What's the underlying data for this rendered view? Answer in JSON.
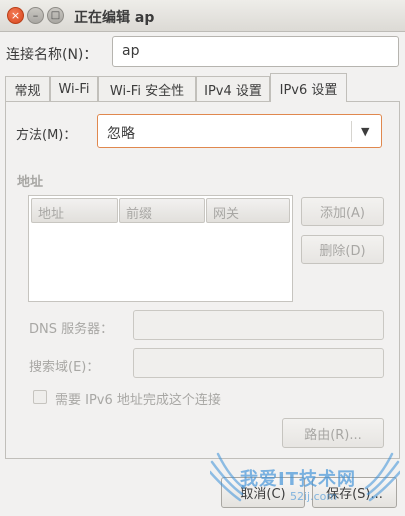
{
  "window": {
    "title": "正在编辑 ap",
    "close_glyph": "×",
    "minimize_glyph": "–",
    "maximize_glyph": "□"
  },
  "connection_name": {
    "label": "连接名称(N)：",
    "value": "ap"
  },
  "tabs": [
    {
      "label": "常规",
      "active": false
    },
    {
      "label": "Wi-Fi",
      "active": false
    },
    {
      "label": "Wi-Fi 安全性",
      "active": false
    },
    {
      "label": "IPv4 设置",
      "active": false
    },
    {
      "label": "IPv6 设置",
      "active": true
    }
  ],
  "ipv6": {
    "method_label": "方法(M)：",
    "method_value": "忽略",
    "address_section": "地址",
    "address_columns": [
      "地址",
      "前缀",
      "网关"
    ],
    "add_button": "添加(A)",
    "delete_button": "删除(D)",
    "dns_label": "DNS 服务器：",
    "search_domain_label": "搜索域(E)：",
    "require_checkbox_label": "需要 IPv6 地址完成这个连接",
    "routes_button": "路由(R)..."
  },
  "footer": {
    "cancel_button": "取消(C)",
    "save_button": "保存(S)..."
  },
  "watermark": {
    "text": "我爱IT技术网",
    "subtext": "52ij.com"
  },
  "colors": {
    "focus_border": "#e0884e",
    "close_button": "#e2572b",
    "watermark": "#3a8fd8"
  },
  "icons": {
    "combo_arrow": "▼"
  }
}
